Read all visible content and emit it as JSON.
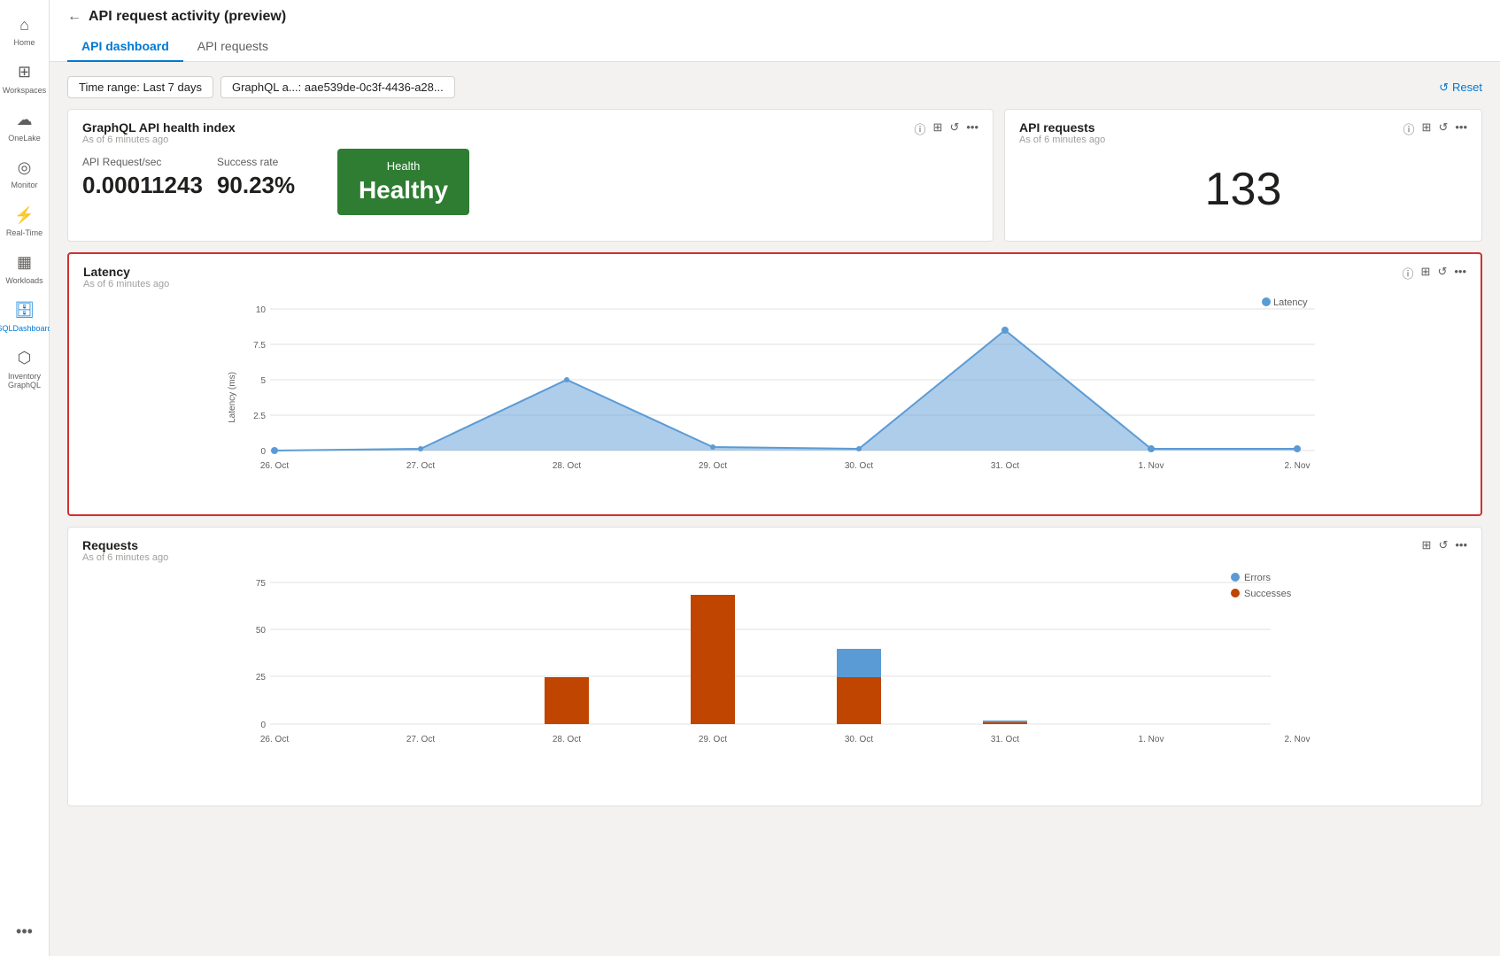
{
  "sidebar": {
    "items": [
      {
        "id": "home",
        "label": "Home",
        "icon": "⌂"
      },
      {
        "id": "workspaces",
        "label": "Workspaces",
        "icon": "⊞"
      },
      {
        "id": "onelake",
        "label": "OneLake",
        "icon": "☁"
      },
      {
        "id": "monitor",
        "label": "Monitor",
        "icon": "◎"
      },
      {
        "id": "realtime",
        "label": "Real-Time",
        "icon": "⚡"
      },
      {
        "id": "workloads",
        "label": "Workloads",
        "icon": "▦"
      },
      {
        "id": "sqldashboard",
        "label": "SQLDashboard",
        "icon": "🗄",
        "active": true
      },
      {
        "id": "inventory",
        "label": "Inventory GraphQL",
        "icon": "⬡"
      }
    ],
    "more_label": "..."
  },
  "topbar": {
    "back_label": "←",
    "title": "API request activity (preview)"
  },
  "tabs": [
    {
      "id": "dashboard",
      "label": "API dashboard",
      "active": true
    },
    {
      "id": "requests",
      "label": "API requests",
      "active": false
    }
  ],
  "filters": {
    "time_range_label": "Time range: Last 7 days",
    "api_filter_label": "GraphQL a...: aae539de-0c3f-4436-a28...",
    "reset_label": "Reset"
  },
  "health_card": {
    "title": "GraphQL API health index",
    "subtitle": "As of 6 minutes ago",
    "metrics": [
      {
        "label": "API Request/sec",
        "value": "0.00011243"
      },
      {
        "label": "Success rate",
        "value": "90.23%"
      }
    ],
    "health": {
      "label": "Health",
      "value": "Healthy",
      "color": "#2e7d32"
    }
  },
  "api_requests_card": {
    "title": "API requests",
    "subtitle": "As of 6 minutes ago",
    "value": "133"
  },
  "latency_chart": {
    "title": "Latency",
    "subtitle": "As of 6 minutes ago",
    "y_label": "Latency (ms)",
    "y_ticks": [
      "10",
      "7.5",
      "5",
      "2.5",
      "0"
    ],
    "x_ticks": [
      "26. Oct",
      "27. Oct",
      "28. Oct",
      "29. Oct",
      "30. Oct",
      "31. Oct",
      "1. Nov",
      "2. Nov"
    ],
    "legend": "Latency",
    "legend_color": "#5b9bd5"
  },
  "requests_chart": {
    "title": "Requests",
    "subtitle": "As of 6 minutes ago",
    "y_ticks": [
      "75",
      "50",
      "25",
      "0"
    ],
    "x_ticks": [
      "26. Oct",
      "27. Oct",
      "28. Oct",
      "29. Oct",
      "30. Oct",
      "31. Oct",
      "1. Nov",
      "2. Nov"
    ],
    "legend": [
      {
        "label": "Errors",
        "color": "#5b9bd5"
      },
      {
        "label": "Successes",
        "color": "#bf4500"
      }
    ]
  }
}
